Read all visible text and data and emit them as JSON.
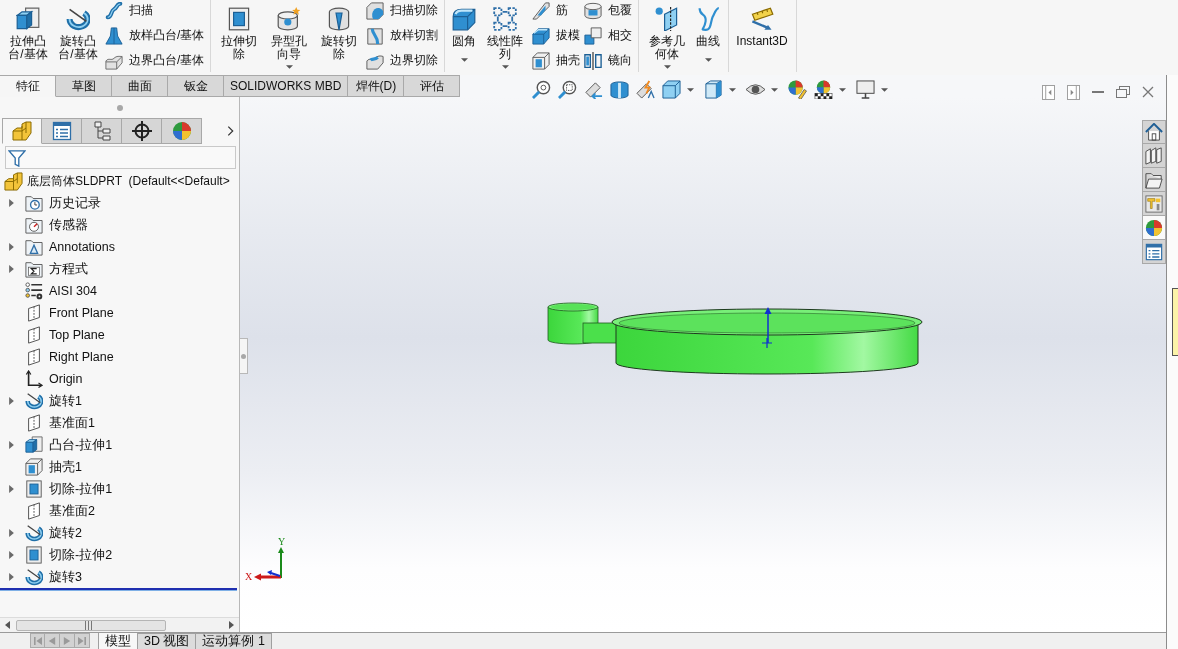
{
  "ribbon": {
    "groups": [
      {
        "buttons": [
          {
            "kind": "large",
            "label": "拉伸凸台/基体",
            "dropdown": false
          },
          {
            "kind": "large",
            "label": "旋转凸台/基体",
            "dropdown": false
          },
          {
            "kind": "small",
            "label": "扫描"
          },
          {
            "kind": "small",
            "label": "放样凸台/基体"
          },
          {
            "kind": "small",
            "label": "边界凸台/基体"
          }
        ]
      },
      {
        "buttons": [
          {
            "kind": "large",
            "label": "拉伸切除",
            "dropdown": false
          },
          {
            "kind": "large",
            "label": "异型孔向导",
            "dropdown": true
          },
          {
            "kind": "large",
            "label": "旋转切除",
            "dropdown": false
          },
          {
            "kind": "small",
            "label": "扫描切除"
          },
          {
            "kind": "small",
            "label": "放样切割"
          },
          {
            "kind": "small",
            "label": "边界切除"
          }
        ]
      },
      {
        "buttons": [
          {
            "kind": "large",
            "label": "圆角",
            "dropdown": true
          },
          {
            "kind": "large",
            "label": "线性阵列",
            "dropdown": true
          },
          {
            "kind": "small",
            "label": "筋"
          },
          {
            "kind": "small",
            "label": "拔模"
          },
          {
            "kind": "small",
            "label": "抽壳"
          },
          {
            "kind": "small",
            "label": "包覆"
          },
          {
            "kind": "small",
            "label": "相交"
          },
          {
            "kind": "small",
            "label": "镜向"
          }
        ]
      },
      {
        "buttons": [
          {
            "kind": "large",
            "label": "参考几何体",
            "dropdown": true
          },
          {
            "kind": "large",
            "label": "曲线",
            "dropdown": true
          }
        ]
      },
      {
        "buttons": [
          {
            "kind": "large",
            "label": "Instant3D",
            "dropdown": false
          }
        ]
      }
    ]
  },
  "command_tabs": [
    {
      "label": "特征",
      "selected": true
    },
    {
      "label": "草图",
      "selected": false
    },
    {
      "label": "曲面",
      "selected": false
    },
    {
      "label": "钣金",
      "selected": false
    },
    {
      "label": "SOLIDWORKS MBD",
      "selected": false
    },
    {
      "label": "焊件(D)",
      "selected": false
    },
    {
      "label": "评估",
      "selected": false
    }
  ],
  "feature_manager": {
    "panel_tabs": [
      {
        "selected": true
      },
      {
        "selected": false
      },
      {
        "selected": false
      },
      {
        "selected": false
      },
      {
        "selected": false
      }
    ],
    "root": {
      "label": "底层筒体SLDPRT  (Default<<Default>"
    },
    "tree": [
      {
        "label": "历史记录",
        "expandable": true
      },
      {
        "label": "传感器",
        "expandable": false
      },
      {
        "label": "Annotations",
        "expandable": true
      },
      {
        "label": "方程式",
        "expandable": true
      },
      {
        "label": "AISI 304",
        "expandable": false
      },
      {
        "label": "Front Plane",
        "expandable": false
      },
      {
        "label": "Top Plane",
        "expandable": false
      },
      {
        "label": "Right Plane",
        "expandable": false
      },
      {
        "label": "Origin",
        "expandable": false
      },
      {
        "label": "旋转1",
        "expandable": true
      },
      {
        "label": "基准面1",
        "expandable": false
      },
      {
        "label": "凸台-拉伸1",
        "expandable": true
      },
      {
        "label": "抽壳1",
        "expandable": false
      },
      {
        "label": "切除-拉伸1",
        "expandable": true
      },
      {
        "label": "基准面2",
        "expandable": false
      },
      {
        "label": "旋转2",
        "expandable": true
      },
      {
        "label": "切除-拉伸2",
        "expandable": true
      },
      {
        "label": "旋转3",
        "expandable": true
      }
    ]
  },
  "task_pane": {
    "tabs": [
      {
        "selected": false
      },
      {
        "selected": false
      },
      {
        "selected": false
      },
      {
        "selected": false
      },
      {
        "selected": true
      },
      {
        "selected": false
      }
    ]
  },
  "triad": {
    "x_label": "X",
    "y_label": "Y"
  },
  "bottom_tabs": [
    {
      "label": "模型",
      "selected": true
    },
    {
      "label": "3D 视图",
      "selected": false
    },
    {
      "label": "运动算例 1",
      "selected": false
    }
  ]
}
